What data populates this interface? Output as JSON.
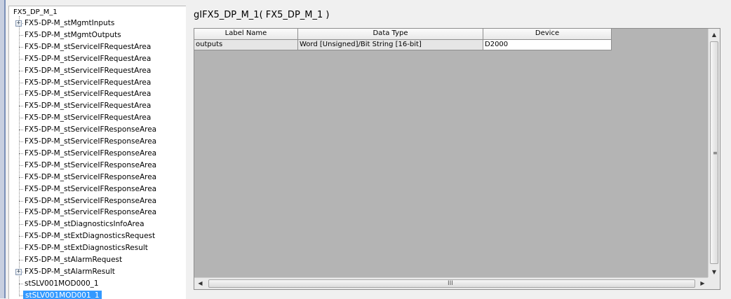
{
  "tree": {
    "root": "FX5_DP_M_1",
    "items": [
      {
        "label": "FX5-DP-M_stMgmtInputs",
        "expander": "+"
      },
      {
        "label": "FX5-DP-M_stMgmtOutputs"
      },
      {
        "label": "FX5-DP-M_stServiceIFRequestArea"
      },
      {
        "label": "FX5-DP-M_stServiceIFRequestArea"
      },
      {
        "label": "FX5-DP-M_stServiceIFRequestArea"
      },
      {
        "label": "FX5-DP-M_stServiceIFRequestArea"
      },
      {
        "label": "FX5-DP-M_stServiceIFRequestArea"
      },
      {
        "label": "FX5-DP-M_stServiceIFRequestArea"
      },
      {
        "label": "FX5-DP-M_stServiceIFRequestArea"
      },
      {
        "label": "FX5-DP-M_stServiceIFResponseArea"
      },
      {
        "label": "FX5-DP-M_stServiceIFResponseArea"
      },
      {
        "label": "FX5-DP-M_stServiceIFResponseArea"
      },
      {
        "label": "FX5-DP-M_stServiceIFResponseArea"
      },
      {
        "label": "FX5-DP-M_stServiceIFResponseArea"
      },
      {
        "label": "FX5-DP-M_stServiceIFResponseArea"
      },
      {
        "label": "FX5-DP-M_stServiceIFResponseArea"
      },
      {
        "label": "FX5-DP-M_stServiceIFResponseArea"
      },
      {
        "label": "FX5-DP-M_stDiagnosticsInfoArea"
      },
      {
        "label": "FX5-DP-M_stExtDiagnosticsRequest"
      },
      {
        "label": "FX5-DP-M_stExtDiagnosticsResult"
      },
      {
        "label": "FX5-DP-M_stAlarmRequest"
      },
      {
        "label": "FX5-DP-M_stAlarmResult",
        "expander": "+"
      },
      {
        "label": "stSLV001MOD000_1"
      },
      {
        "label": "stSLV001MOD001_1",
        "selected": true
      }
    ]
  },
  "panel": {
    "title": "gIFX5_DP_M_1( FX5_DP_M_1 )"
  },
  "grid": {
    "headers": [
      "Label Name",
      "Data Type",
      "Device"
    ],
    "rows": [
      [
        "outputs",
        "Word [Unsigned]/Bit String [16-bit]",
        "D2000"
      ]
    ]
  },
  "scrollbars": {
    "up_arrow": "▲",
    "down_arrow": "▼",
    "left_arrow": "◀",
    "right_arrow": "▶",
    "v_grip": "≡",
    "h_grip": "III"
  },
  "colors": {
    "selection": "#3399ff",
    "grid_background": "#b4b4b4"
  }
}
